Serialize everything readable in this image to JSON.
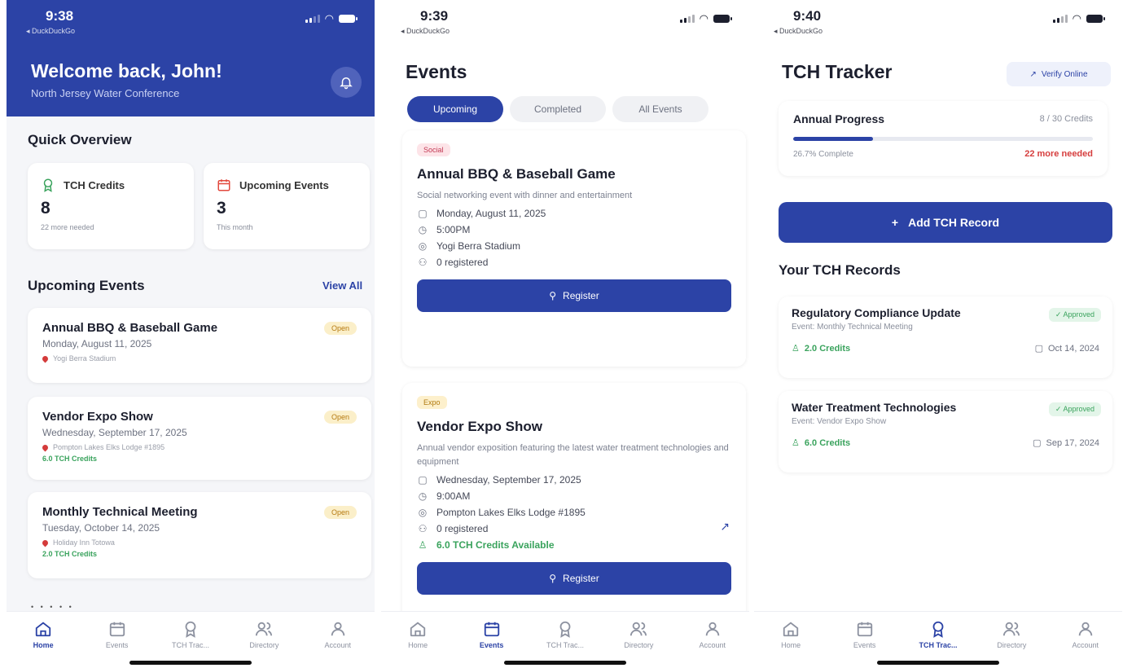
{
  "colors": {
    "primary": "#2c43a6",
    "open_badge": "#fbefc9",
    "approved": "#3aa35d",
    "needed": "#d63e3e"
  },
  "tabs": [
    {
      "label": "Home",
      "icon": "home-icon"
    },
    {
      "label": "Events",
      "icon": "calendar-icon"
    },
    {
      "label": "TCH Trac...",
      "icon": "award-icon"
    },
    {
      "label": "Directory",
      "icon": "users-icon"
    },
    {
      "label": "Account",
      "icon": "user-icon"
    }
  ],
  "screen1": {
    "time": "9:38",
    "back": "◂ DuckDuckGo",
    "welcome": "Welcome back, John!",
    "subtitle": "North Jersey Water Conference",
    "quick_overview": "Quick Overview",
    "overview": [
      {
        "label": "TCH Credits",
        "value": "8",
        "sub": "22 more needed"
      },
      {
        "label": "Upcoming Events",
        "value": "3",
        "sub": "This month"
      }
    ],
    "upcoming_title": "Upcoming Events",
    "view_all": "View All",
    "events": [
      {
        "title": "Annual BBQ & Baseball Game",
        "badge": "Open",
        "date": "Monday, August 11, 2025",
        "location": "Yogi Berra Stadium",
        "credits": ""
      },
      {
        "title": "Vendor Expo Show",
        "badge": "Open",
        "date": "Wednesday, September 17, 2025",
        "location": "Pompton Lakes Elks Lodge #1895",
        "credits": "6.0 TCH Credits"
      },
      {
        "title": "Monthly Technical Meeting",
        "badge": "Open",
        "date": "Tuesday, October 14, 2025",
        "location": "Holiday Inn Totowa",
        "credits": "2.0 TCH Credits"
      }
    ],
    "active_tab": "Home"
  },
  "screen2": {
    "time": "9:39",
    "back": "◂ DuckDuckGo",
    "title": "Events",
    "filters": [
      "Upcoming",
      "Completed",
      "All Events"
    ],
    "events": [
      {
        "category": "Social",
        "title": "Annual BBQ & Baseball Game",
        "description": "Social networking event with dinner and entertainment",
        "date": "Monday, August 11, 2025",
        "time": "5:00PM",
        "location": "Yogi Berra Stadium",
        "registered": "0 registered",
        "credits": "",
        "button": "Register"
      },
      {
        "category": "Expo",
        "title": "Vendor Expo Show",
        "description": "Annual vendor exposition featuring the latest water treatment technologies and equipment",
        "date": "Wednesday, September 17, 2025",
        "time": "9:00AM",
        "location": "Pompton Lakes Elks Lodge #1895",
        "registered": "0 registered",
        "credits": "6.0 TCH Credits Available",
        "button": "Register"
      }
    ],
    "active_tab": "Events"
  },
  "screen3": {
    "time": "9:40",
    "back": "◂ DuckDuckGo",
    "title": "TCH Tracker",
    "verify": "Verify Online",
    "progress": {
      "title": "Annual Progress",
      "credits": "8 / 30 Credits",
      "percent_text": "26.7% Complete",
      "fraction": 0.267,
      "needed": "22 more needed"
    },
    "add_button": "Add TCH Record",
    "records_title": "Your TCH Records",
    "records": [
      {
        "title": "Regulatory Compliance Update",
        "status": "Approved",
        "event": "Event: Monthly Technical Meeting",
        "credits": "2.0 Credits",
        "date": "Oct 14, 2024"
      },
      {
        "title": "Water Treatment Technologies",
        "status": "Approved",
        "event": "Event: Vendor Expo Show",
        "credits": "6.0 Credits",
        "date": "Sep 17, 2024"
      }
    ],
    "active_tab": "TCH Trac..."
  }
}
